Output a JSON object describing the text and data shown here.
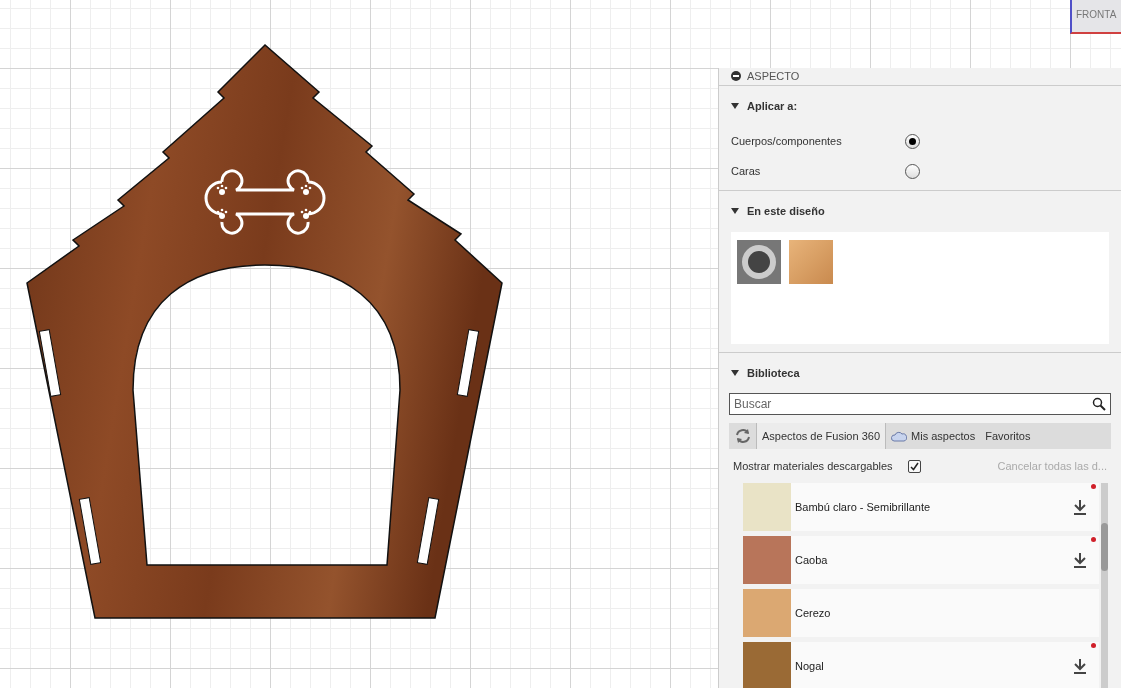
{
  "view_cube": {
    "label": "FRONTA"
  },
  "panel": {
    "title": "ASPECTO",
    "apply_to": {
      "title": "Aplicar a:",
      "expanded": true,
      "options": [
        {
          "label": "Cuerpos/componentes",
          "selected": true
        },
        {
          "label": "Caras",
          "selected": false
        }
      ]
    },
    "in_design": {
      "title": "En este diseño",
      "expanded": true,
      "appearances": [
        {
          "kind": "chrome"
        },
        {
          "kind": "wood"
        }
      ]
    },
    "library": {
      "title": "Biblioteca",
      "expanded": true,
      "search": {
        "placeholder": "Buscar"
      },
      "tabs": [
        {
          "label": "Aspectos de Fusion 360",
          "selected": true,
          "kind": "plain"
        },
        {
          "label": "Mis aspectos",
          "selected": false,
          "kind": "cloud"
        },
        {
          "label": "Favoritos",
          "selected": false,
          "kind": "plain"
        }
      ],
      "show_downloadable": {
        "label": "Mostrar materiales descargables",
        "checked": true
      },
      "cancel_link": "Cancelar todas las d...",
      "materials": [
        {
          "name": "Bambú claro - Semibrillante",
          "color": "#e9e3c6",
          "downloadable": true
        },
        {
          "name": "Caoba",
          "color": "#b8755a",
          "downloadable": true
        },
        {
          "name": "Cerezo",
          "color": "#dba872",
          "downloadable": false
        },
        {
          "name": "Nogal",
          "color": "#9a6a35",
          "downloadable": true
        }
      ]
    }
  }
}
